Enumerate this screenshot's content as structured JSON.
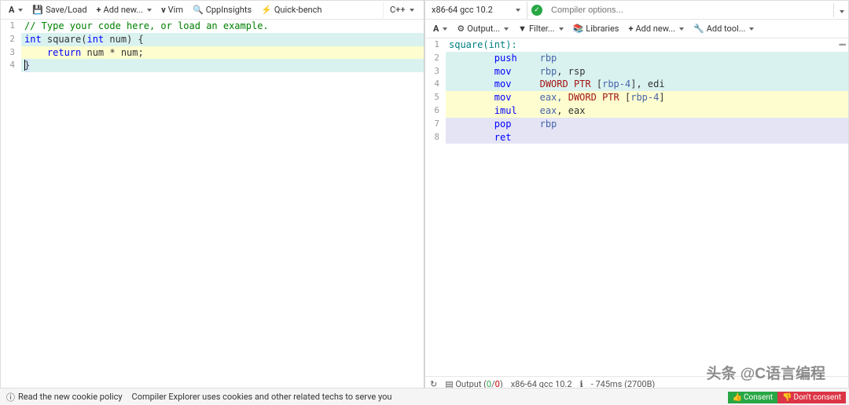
{
  "left_toolbar": {
    "font_menu": "A",
    "save_load": "Save/Load",
    "add_new": "Add new...",
    "vim": "Vim",
    "cppinsights": "CppInsights",
    "quickbench": "Quick-bench",
    "language": "C++"
  },
  "left_code": {
    "lines": [
      "1",
      "2",
      "3",
      "4"
    ],
    "l1": "// Type your code here, or load an example.",
    "l2_a": "int",
    "l2_b": " square(",
    "l2_c": "int",
    "l2_d": " num) {",
    "l3_a": "    return",
    "l3_b": " num * num;",
    "l4": "}"
  },
  "right_top": {
    "compiler": "x86-64 gcc 10.2",
    "options_placeholder": "Compiler options..."
  },
  "right_toolbar": {
    "font_menu": "A",
    "output": "Output...",
    "filter": "Filter...",
    "libraries": "Libraries",
    "add_new": "Add new...",
    "add_tool": "Add tool..."
  },
  "asm": {
    "lines": [
      "1",
      "2",
      "3",
      "4",
      "5",
      "6",
      "7",
      "8"
    ],
    "l1": "square(int):",
    "l2_op": "push",
    "l2_args": "rbp",
    "l3_op": "mov",
    "l3_a": "rbp",
    "l3_b": ", rsp",
    "l4_op": "mov",
    "l4_a": "DWORD PTR ",
    "l4_b": "[",
    "l4_c": "rbp-4",
    "l4_d": "], edi",
    "l5_op": "mov",
    "l5_a": "eax, ",
    "l5_b": "DWORD PTR ",
    "l5_c": "[",
    "l5_d": "rbp-4",
    "l5_e": "]",
    "l6_op": "imul",
    "l6_a": "eax",
    "l6_b": ", eax",
    "l7_op": "pop",
    "l7_a": "rbp",
    "l8_op": "ret"
  },
  "status": {
    "output_label": "Output (",
    "out_ok": "0",
    "out_sep": "/",
    "out_err": "0",
    "out_close": ")",
    "compiler": "x86-64 gcc 10.2",
    "timing": "- 745ms (2700B)"
  },
  "cookie": {
    "read": "Read the new cookie policy",
    "msg": "Compiler Explorer uses cookies and other related techs to serve you",
    "consent": "Consent",
    "dont": "Don't consent"
  },
  "watermark": "头条 @C语言编程"
}
